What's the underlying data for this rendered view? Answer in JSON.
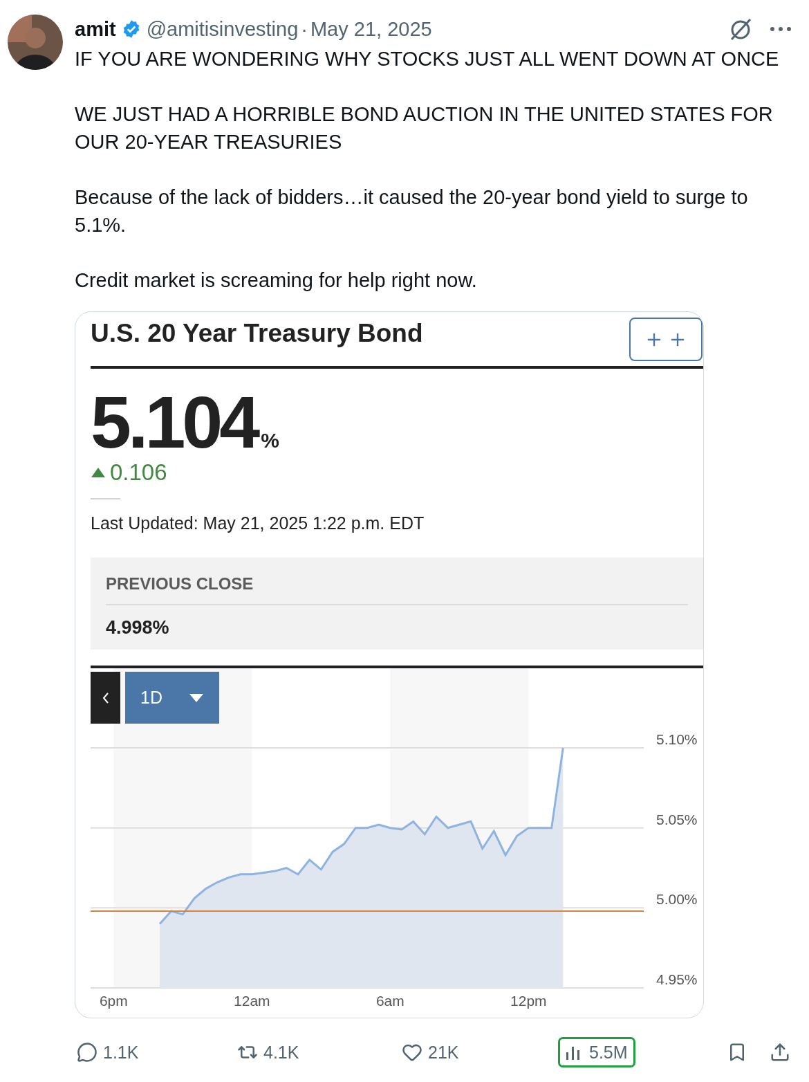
{
  "author": {
    "name": "amit",
    "verified": true,
    "handle": "@amitisinvesting",
    "separator": "·",
    "date": "May 21, 2025"
  },
  "post": {
    "paragraphs": [
      "IF YOU ARE WONDERING WHY STOCKS JUST ALL WENT DOWN AT ONCE",
      "WE JUST HAD A HORRIBLE BOND AUCTION IN THE UNITED STATES FOR OUR 20-YEAR TREASURIES",
      "Because of the lack of bidders…it caused the 20-year bond yield to surge to 5.1%.",
      "Credit market is screaming for help right now."
    ]
  },
  "card": {
    "title": "U.S. 20 Year Treasury Bond",
    "value": "5.104",
    "unit": "%",
    "up": true,
    "change": "0.106",
    "updated": "Last Updated: May 21, 2025 1:22 p.m. EDT",
    "previous_close": {
      "label": "PREVIOUS CLOSE",
      "value": "4.998%"
    },
    "range": "1D",
    "chart_data": {
      "type": "area",
      "categories": [
        "6pm",
        null,
        null,
        null,
        null,
        null,
        null,
        null,
        null,
        null,
        null,
        null,
        "12am",
        null,
        null,
        null,
        null,
        null,
        null,
        null,
        null,
        null,
        null,
        null,
        "6am",
        null,
        null,
        null,
        null,
        null,
        null,
        null,
        null,
        null,
        null,
        null,
        "12pm",
        null,
        null,
        null,
        null,
        null,
        null,
        null,
        null,
        null
      ],
      "series": [
        {
          "color": "#8fb3e0",
          "values": [
            null,
            null,
            null,
            null,
            4.99,
            4.998,
            4.996,
            5.006,
            5.012,
            5.016,
            5.019,
            5.021,
            5.021,
            5.022,
            5.023,
            5.025,
            5.021,
            5.03,
            5.024,
            5.035,
            5.04,
            5.05,
            5.05,
            5.052,
            5.05,
            5.049,
            5.054,
            5.046,
            5.057,
            5.05,
            5.052,
            5.054,
            5.037,
            5.048,
            5.033,
            5.045,
            5.05,
            5.05,
            5.05,
            5.1,
            null,
            null,
            null,
            null,
            null,
            null
          ]
        }
      ],
      "ylim": [
        4.95,
        5.1
      ],
      "grid": true,
      "yticks": [
        {
          "value": 5.1,
          "label": "5.10%"
        },
        {
          "value": 5.05,
          "label": "5.05%"
        },
        {
          "value": 5.0,
          "label": "5.00%"
        },
        {
          "value": 4.95,
          "label": "4.95%"
        }
      ],
      "ref_lines": [
        {
          "axis": "y",
          "value": 4.998,
          "color": "#d9823b"
        }
      ]
    }
  },
  "actions": [
    {
      "kind": "reply",
      "count": "1.1K",
      "highlighted": false
    },
    {
      "kind": "repost",
      "count": "4.1K",
      "highlighted": false
    },
    {
      "kind": "like",
      "count": "21K",
      "highlighted": false
    },
    {
      "kind": "views",
      "count": "5.5M",
      "highlighted": true
    },
    {
      "kind": "bookmark",
      "highlighted": false
    },
    {
      "kind": "share",
      "highlighted": false
    }
  ]
}
